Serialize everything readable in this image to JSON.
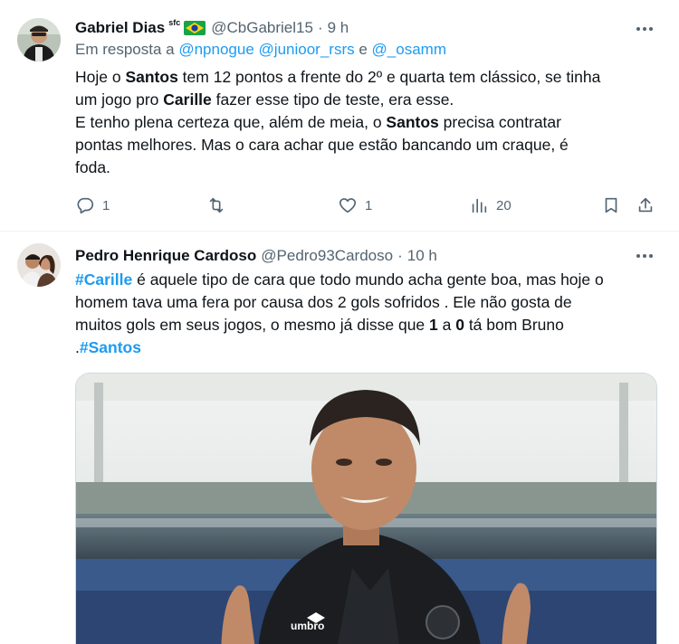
{
  "tweet1": {
    "author_name": "Gabriel Dias",
    "author_badge": "sfc",
    "flag": "BR",
    "handle": "@CbGabriel15",
    "separator": "·",
    "time": "9 h",
    "more_icon": "more-icon",
    "reply_prefix": "Em resposta a",
    "reply_users": [
      "@npnogue",
      "@junioor_rsrs"
    ],
    "reply_conjunction": "e",
    "reply_last": "@_osamm",
    "lines": [
      [
        "Hoje o ",
        "Santos",
        " tem 12 pontos a frente do 2º e quarta tem clássico, se tinha"
      ],
      [
        "um jogo pro ",
        "Carille",
        " fazer esse tipo de teste, era esse."
      ],
      [
        "E tenho plena certeza que, além de meia, o ",
        "Santos",
        " precisa contratar"
      ],
      [
        "pontas melhores. Mas o cara achar que estão bancando um craque, é"
      ],
      [
        "foda."
      ]
    ],
    "actions": {
      "reply_count": "1",
      "retweet_count": "",
      "like_count": "1",
      "views_count": "20"
    }
  },
  "tweet2": {
    "author_name": "Pedro Henrique Cardoso",
    "handle": "@Pedro93Cardoso",
    "separator": "·",
    "time": "10 h",
    "hashtag1": "#Carille",
    "line1_rest": " é aquele tipo de cara que todo mundo acha gente boa, mas hoje o",
    "line2": "homem tava uma fera por causa dos 2 gols sofridos . Ele não gosta de",
    "line3_before": "muitos gols em seus jogos, o mesmo já disse que ",
    "line3_bold1": "1",
    "line3_mid": " a ",
    "line3_bold2": "0",
    "line3_after": " tá bom Bruno",
    "line4_prefix": ".",
    "hashtag2": "#Santos",
    "media_text": "umbro"
  },
  "colors": {
    "text": "#0f1419",
    "secondary": "#536471",
    "link": "#1d9bf0",
    "divider": "#eff3f4"
  }
}
